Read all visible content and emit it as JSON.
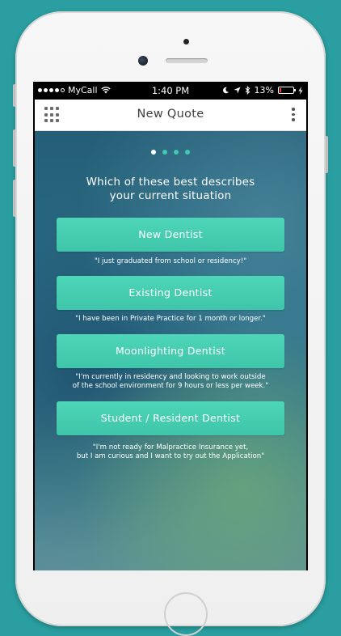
{
  "status_bar": {
    "carrier": "MyCall",
    "time": "1:40 PM",
    "battery_percent": "13%",
    "battery_level": 0.13,
    "icons": [
      "signal-dots-icon",
      "wifi-icon",
      "moon-icon",
      "location-arrow-icon",
      "bluetooth-icon",
      "battery-icon",
      "charging-bolt-icon"
    ]
  },
  "nav": {
    "title": "New Quote",
    "left_icon": "grid-menu-icon",
    "right_icon": "kebab-menu-icon"
  },
  "pager": {
    "total": 4,
    "active_index": 0
  },
  "question": {
    "line1": "Which of these best describes",
    "line2": "your current situation"
  },
  "options": [
    {
      "label": "New Dentist",
      "caption_lines": [
        "\"I just graduated from school or residency!\""
      ]
    },
    {
      "label": "Existing Dentist",
      "caption_lines": [
        "\"I have been in Private Practice for 1 month or longer.\""
      ]
    },
    {
      "label": "Moonlighting Dentist",
      "caption_lines": [
        "\"I'm currently in residency and looking to work outside",
        "of the school environment for 9 hours or less per week.\""
      ]
    },
    {
      "label": "Student / Resident Dentist",
      "caption_lines": [
        "\"I'm not ready for Malpractice Insurance yet,",
        "but I am curious and I want to try out the Application\""
      ]
    }
  ],
  "colors": {
    "accent": "#45cdb1",
    "page_background": "#2a9ea0",
    "battery_low": "#ff3b30"
  }
}
